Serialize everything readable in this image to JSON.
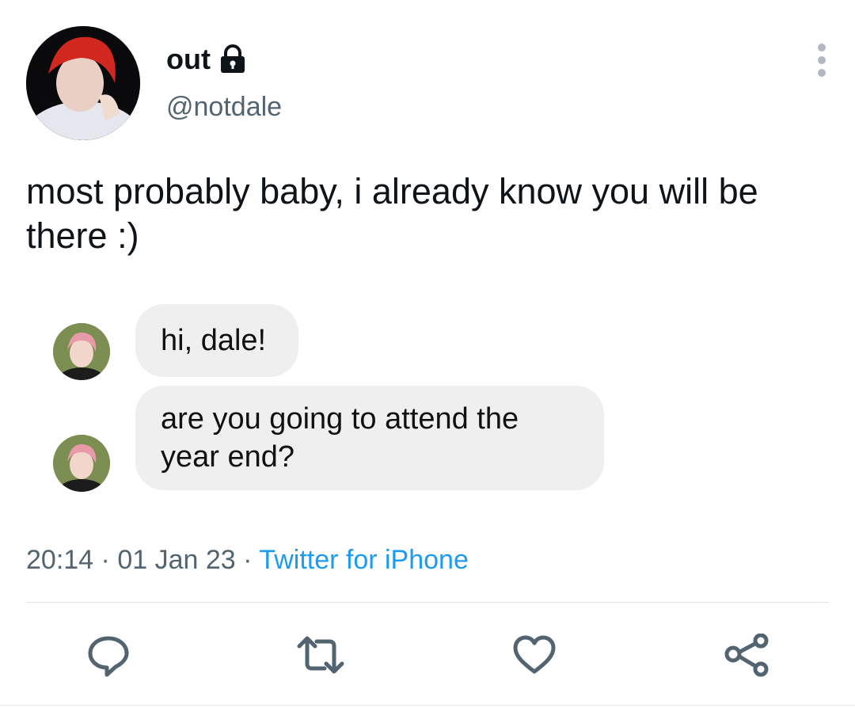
{
  "tweet": {
    "display_name": "out",
    "handle": "@notdale",
    "text": "most probably baby, i already know you will be there :)",
    "time": "20:14",
    "date": "01 Jan 23",
    "separator": "·",
    "source": "Twitter for iPhone"
  },
  "dm": {
    "messages": [
      {
        "text": "hi, dale!"
      },
      {
        "text": "are you going to attend the year end?"
      }
    ]
  },
  "actions": {
    "reply_icon": "reply-icon",
    "retweet_icon": "retweet-icon",
    "like_icon": "like-icon",
    "share_icon": "share-icon"
  },
  "colors": {
    "handle_gray": "#536471",
    "link_blue": "#1d9bf0",
    "bubble_gray": "#efefef"
  }
}
